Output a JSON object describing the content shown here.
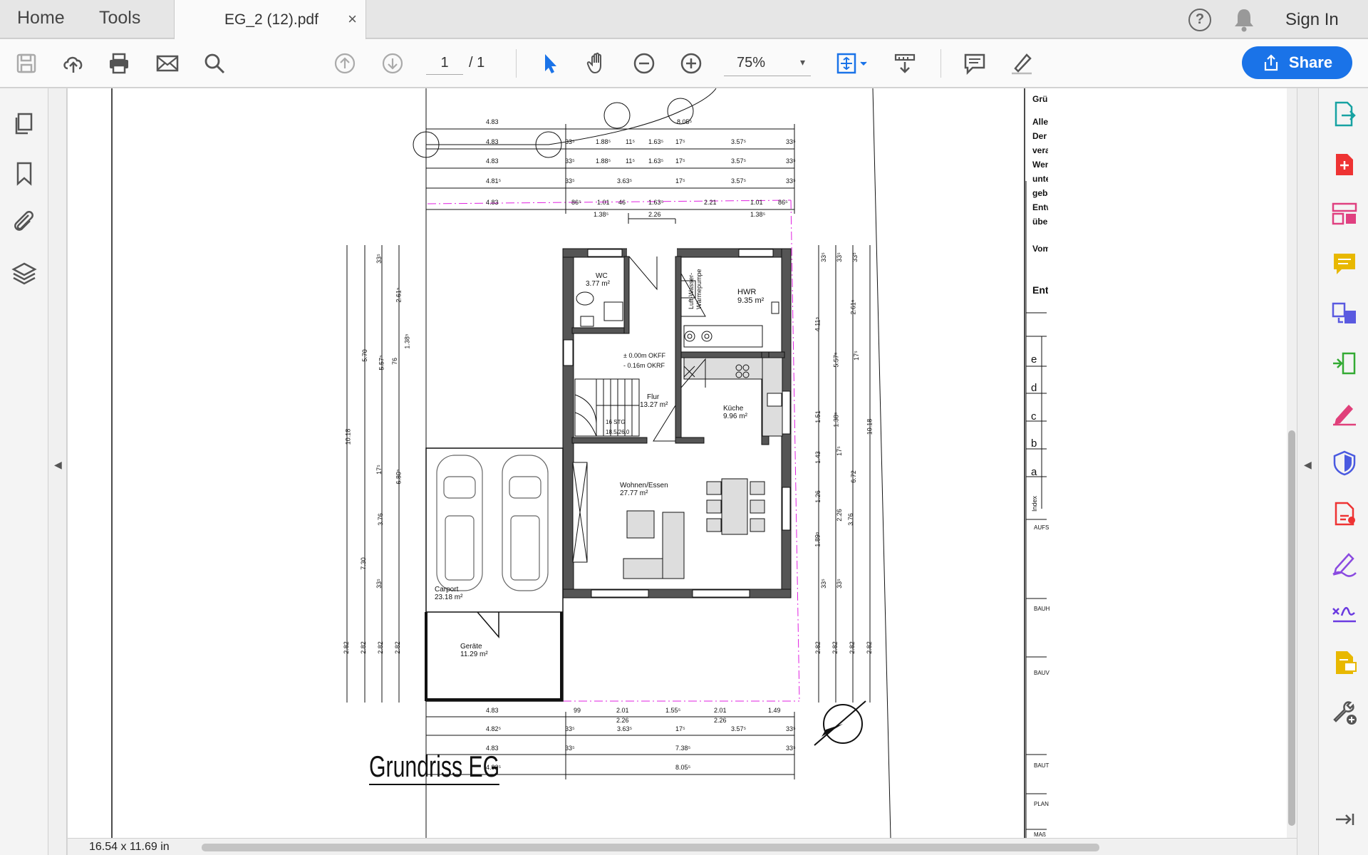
{
  "tabs": {
    "home": "Home",
    "tools": "Tools"
  },
  "document": {
    "tab_title": "EG_2 (12).pdf",
    "close_glyph": "×"
  },
  "header": {
    "sign_in": "Sign In",
    "help_glyph": "?"
  },
  "toolbar": {
    "icons": [
      "save-icon",
      "upload-icon",
      "print-icon",
      "mail-icon",
      "search-icon",
      "prev-page-icon",
      "next-page-icon",
      "select-tool-icon",
      "hand-tool-icon",
      "zoom-out-icon",
      "zoom-in-icon",
      "fit-page-icon",
      "scroll-mode-icon",
      "comment-icon",
      "highlight-icon",
      "share-icon"
    ],
    "page_current": "1",
    "page_total": "/ 1",
    "zoom": "75%",
    "zoom_caret": "▾",
    "share_label": "Share"
  },
  "left_panel": {
    "icons": [
      "pages-icon",
      "bookmark-icon",
      "attachment-icon",
      "layers-icon"
    ],
    "collapse_glyph": "◀"
  },
  "right_panel": {
    "collapse_glyph": "◀",
    "icons": [
      "export-pdf-icon",
      "create-pdf-icon",
      "organize-pages-icon",
      "comment-tool-icon",
      "combine-files-icon",
      "compress-icon",
      "edit-pdf-icon",
      "protect-icon",
      "fill-sign-icon",
      "sign-icon",
      "request-signature-icon",
      "send-review-icon",
      "more-tools-icon",
      "collapse-panel-icon"
    ]
  },
  "plan": {
    "title": "Grundriss EG",
    "rooms": [
      {
        "name": "WC",
        "area": "3.77 m²"
      },
      {
        "name": "HWR",
        "area": "9.35 m²"
      },
      {
        "name": "Flur",
        "area": "13.27 m²"
      },
      {
        "name": "Küche",
        "area": "9.96 m²"
      },
      {
        "name": "Wohnen/Essen",
        "area": "27.77 m²"
      },
      {
        "name": "Carport",
        "area": "23.18 m²"
      },
      {
        "name": "Geräte",
        "area": "11.29 m²"
      }
    ],
    "heatpump_label": [
      "Luft-Wasser-",
      "Wärmepumpe"
    ],
    "level_labels": [
      "± 0.00m OKFF",
      "- 0.16m OKRF"
    ],
    "stair_labels": [
      "16 STG",
      "18.5/26.0"
    ],
    "top_dims": [
      [
        "4.83",
        "33⁵",
        "1.88⁵",
        "11⁵",
        "1.63⁵",
        "17⁵",
        "3.57⁵",
        "33⁵"
      ],
      [
        "4.83",
        "33⁵",
        "1.88⁵",
        "11⁵",
        "1.63⁵",
        "17⁵",
        "3.57⁵",
        "33⁵"
      ],
      [
        "4.81⁵",
        "33⁵",
        "3.63⁵",
        "17⁵",
        "3.57⁵",
        "33⁵"
      ],
      [
        "4.83",
        "86⁵",
        "1.01",
        "46",
        "1.63⁵",
        "2.21",
        "1.01",
        "86⁵"
      ]
    ],
    "top_extra": [
      "8.05⁵",
      "1.38⁵",
      "2.26",
      "1.38⁵"
    ],
    "bottom_dims": [
      [
        "4.83",
        "99",
        "2.01",
        "1.55⁵",
        "2.01",
        "1.49"
      ],
      [
        "4.82⁵",
        "33⁵",
        "3.63⁵",
        "17⁵",
        "3.57⁵",
        "33⁵"
      ],
      [
        "4.83",
        "33⁵",
        "7.38⁵",
        "33⁵"
      ],
      [
        "4.82⁵",
        "8.05⁵"
      ]
    ],
    "bottom_extra": [
      "2.26",
      "2.26"
    ],
    "left_dims": [
      "5.70",
      "5.57⁵",
      "2.61⁵",
      "1.38⁵",
      "33⁵",
      "76",
      "10.18",
      "17⁵",
      "6.80⁵",
      "3.76",
      "7.30",
      "33⁵",
      "2.82",
      "2.82",
      "2.82",
      "2.82"
    ],
    "right_dims": [
      "33⁵",
      "4.11⁵",
      "1.51",
      "1.43",
      "1.26",
      "1.89⁵",
      "33⁵",
      "2.82",
      "33⁵",
      "5.57⁵",
      "1.38⁵",
      "17⁵",
      "2.26",
      "3.76",
      "33⁵",
      "2.82",
      "33⁵",
      "2.61⁵",
      "17⁵",
      "6.72",
      "2.82",
      "10.18",
      "2.82"
    ],
    "sidebar_text": [
      "Grün",
      "Alle",
      "Der",
      "vera",
      "Wenn",
      "unte",
      "geba",
      "Entw",
      "über",
      "Vom",
      "Entw"
    ],
    "index_rows": [
      "e",
      "d",
      "c",
      "b",
      "a"
    ],
    "index_label": "Index",
    "titleblock_rows": [
      "AUFS",
      "BAUH",
      "BAUV",
      "BAUT",
      "PLAN",
      "MAß"
    ]
  },
  "status": {
    "page_size": "16.54 x 11.69 in"
  }
}
